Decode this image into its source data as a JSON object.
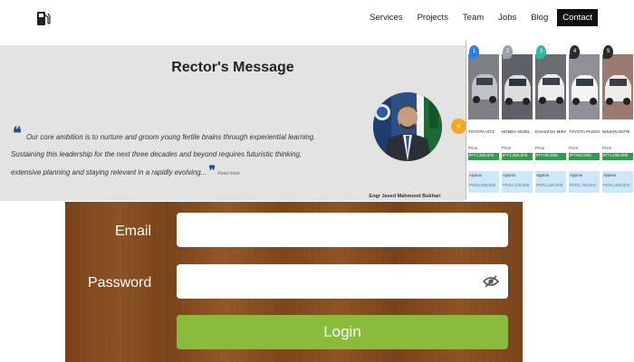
{
  "nav": {
    "logo_icon": "fuel-pump-icon",
    "links": [
      "Services",
      "Projects",
      "Team",
      "Jobs",
      "Blog",
      "Contact"
    ],
    "active": "Contact"
  },
  "rector": {
    "title": "Rector's Message",
    "quote": "Our core ambition is to nurture and groom young fertile brains through experiential learning. Sustaining this leadership for the next three decades and beyond requires futuristic thinking, extensive planning and staying relevant in a rapidly evolving...",
    "quote_source": "Read more",
    "caption": "Engr Javed Mahmood Bukhari",
    "share_icon": "share-icon"
  },
  "cars": [
    {
      "num": "1",
      "badge_color": "#2d7ee0",
      "name": "TOYOTA VITZ",
      "price_label": "Price",
      "price": "JPY1,200,000",
      "approx_label": "Approx",
      "approx": "PKR2,300,000"
    },
    {
      "num": "2",
      "badge_color": "#9aa3ad",
      "name": "HONDA VEZEL",
      "price_label": "Price",
      "price": "JPY1,650,000",
      "approx_label": "Approx",
      "approx": "PKR3,100,000"
    },
    {
      "num": "3",
      "badge_color": "#33b7a5",
      "name": "DAIHATSU MIRA ES",
      "price_label": "Price",
      "price": "JPY780,000",
      "approx_label": "Approx",
      "approx": "PKR1,450,000"
    },
    {
      "num": "4",
      "badge_color": "#2b2b2b",
      "name": "TOYOTA PASSO",
      "price_label": "Price",
      "price": "JPY920,000",
      "approx_label": "Approx",
      "approx": "PKR1,750,000"
    },
    {
      "num": "5",
      "badge_color": "#2b2b2b",
      "name": "NISSAN NOTE",
      "price_label": "Price",
      "price": "JPY1,050,000",
      "approx_label": "Approx",
      "approx": "PKR1,980,000"
    }
  ],
  "login": {
    "email_label": "Email",
    "password_label": "Password",
    "email_value": "",
    "password_value": "",
    "button_label": "Login",
    "eye_icon": "eye-slash-icon",
    "button_color": "#8bbb3c"
  }
}
